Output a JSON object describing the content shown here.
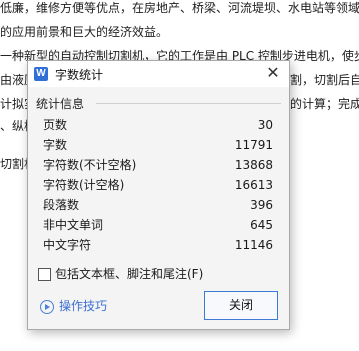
{
  "document": {
    "lines": [
      "低廉，维修方便等优点，在房地产、桥梁、河流堤坝、水电站等领域",
      "的应用前景和巨大的经济效益。",
      "一种新型的自动控制切割机，它的工作是由 PLC 控制步进电机，使步",
      "由液压",
      "割，切割后自",
      "计拟实",
      "的计算；完成",
      "、纵横",
      "切割机"
    ]
  },
  "dialog": {
    "title": "字数统计",
    "app_icon_glyph": "W",
    "close_glyph": "✕",
    "group_label": "统计信息",
    "stats": [
      {
        "label": "页数",
        "value": "30"
      },
      {
        "label": "字数",
        "value": "11791"
      },
      {
        "label": "字符数(不计空格)",
        "value": "13868"
      },
      {
        "label": "字符数(计空格)",
        "value": "16613"
      },
      {
        "label": "段落数",
        "value": "396"
      },
      {
        "label": "非中文单词",
        "value": "645"
      },
      {
        "label": "中文字符",
        "value": "11146"
      }
    ],
    "checkbox_label": "包括文本框、脚注和尾注(F)",
    "checkbox_checked": false,
    "tips_label": "操作技巧",
    "close_button_label": "关闭"
  }
}
